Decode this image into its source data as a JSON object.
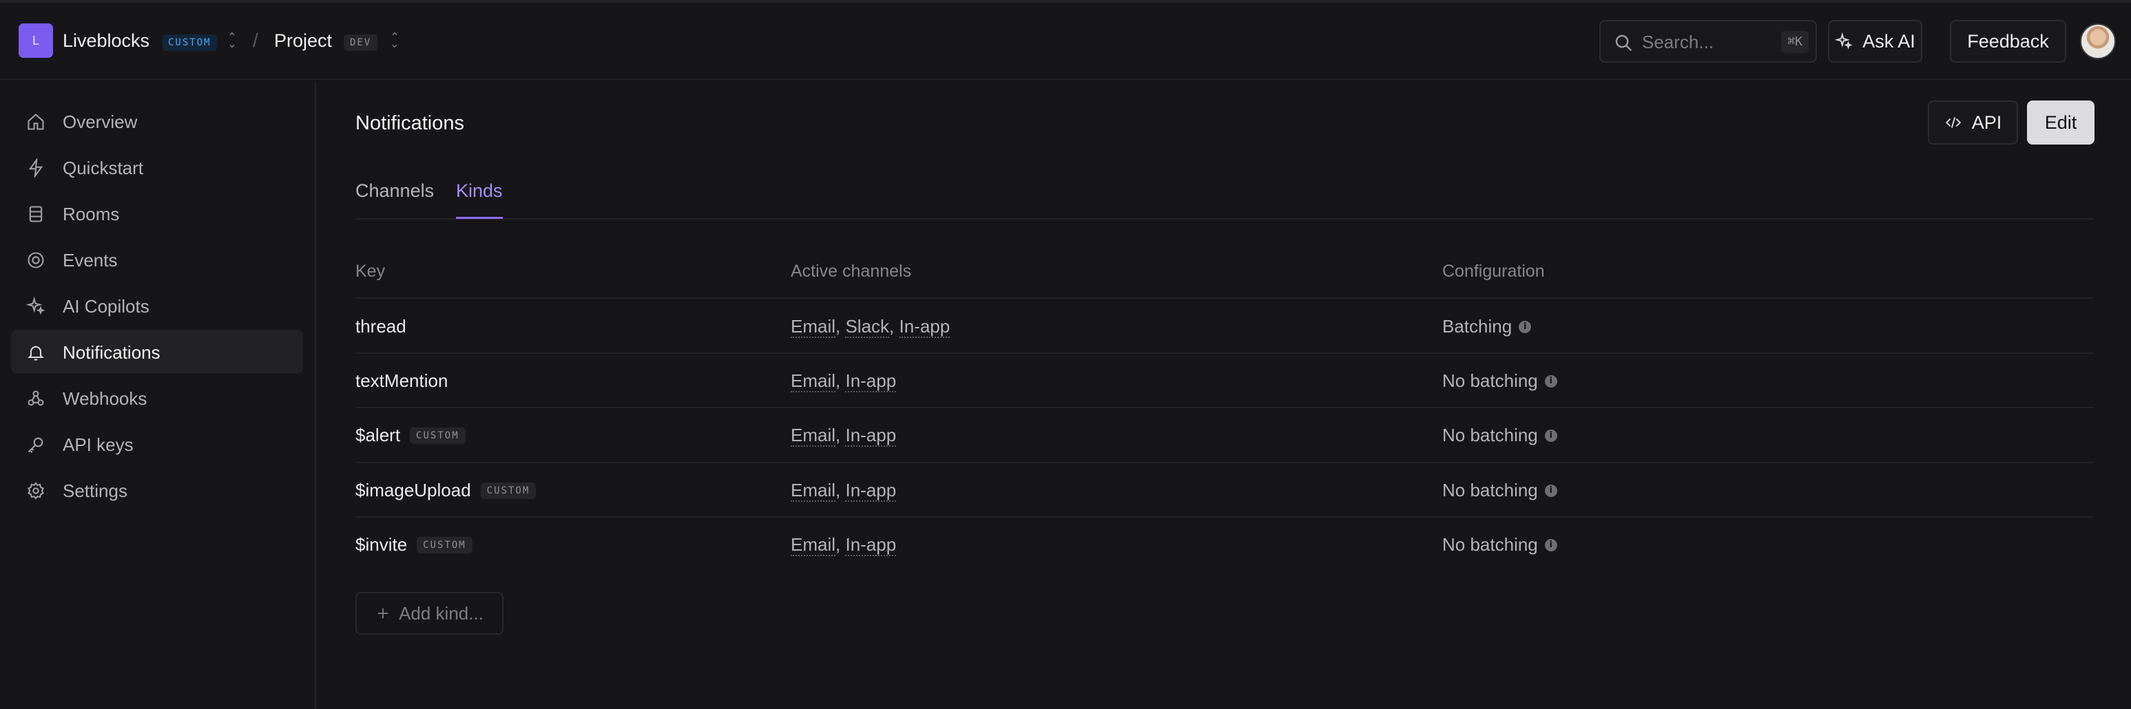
{
  "header": {
    "org_initial": "L",
    "org_name": "Liveblocks",
    "org_badge": "CUSTOM",
    "separator": "/",
    "project_name": "Project",
    "project_badge": "DEV",
    "search_placeholder": "Search...",
    "search_shortcut": "⌘K",
    "ask_ai_label": "Ask AI",
    "feedback_label": "Feedback"
  },
  "sidebar": {
    "items": [
      {
        "label": "Overview",
        "icon": "home-icon"
      },
      {
        "label": "Quickstart",
        "icon": "bolt-icon"
      },
      {
        "label": "Rooms",
        "icon": "rooms-icon"
      },
      {
        "label": "Events",
        "icon": "events-icon"
      },
      {
        "label": "AI Copilots",
        "icon": "sparkle-icon"
      },
      {
        "label": "Notifications",
        "icon": "bell-icon",
        "active": true
      },
      {
        "label": "Webhooks",
        "icon": "webhook-icon"
      },
      {
        "label": "API keys",
        "icon": "key-icon"
      },
      {
        "label": "Settings",
        "icon": "gear-icon"
      }
    ]
  },
  "main": {
    "title": "Notifications",
    "api_label": "API",
    "edit_label": "Edit",
    "tabs": [
      {
        "label": "Channels",
        "active": false
      },
      {
        "label": "Kinds",
        "active": true
      }
    ],
    "columns": [
      "Key",
      "Active channels",
      "Configuration"
    ],
    "rows": [
      {
        "key": "thread",
        "custom": "",
        "channels": [
          "Email",
          "Slack",
          "In-app"
        ],
        "config": "Batching"
      },
      {
        "key": "textMention",
        "custom": "",
        "channels": [
          "Email",
          "In-app"
        ],
        "config": "No batching"
      },
      {
        "key": "$alert",
        "custom": "CUSTOM",
        "channels": [
          "Email",
          "In-app"
        ],
        "config": "No batching"
      },
      {
        "key": "$imageUpload",
        "custom": "CUSTOM",
        "channels": [
          "Email",
          "In-app"
        ],
        "config": "No batching"
      },
      {
        "key": "$invite",
        "custom": "CUSTOM",
        "channels": [
          "Email",
          "In-app"
        ],
        "config": "No batching"
      }
    ],
    "add_kind_label": "Add kind..."
  },
  "colors": {
    "accent": "#8b6df0",
    "brand_logo": "#7a5cf0",
    "badge_blue": "#49a8f0",
    "background": "#161618"
  }
}
